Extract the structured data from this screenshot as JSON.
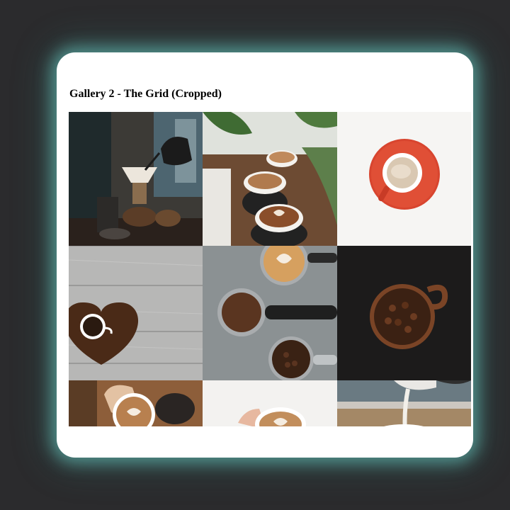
{
  "gallery": {
    "title": "Gallery 2 - The Grid (Cropped)",
    "photos": [
      {
        "subject": "pour-over coffee brewing bar with kettle"
      },
      {
        "subject": "cafe table with latte cups and plants"
      },
      {
        "subject": "red cup of latte on white background"
      },
      {
        "subject": "coffee cup inside heart of coffee beans on wood"
      },
      {
        "subject": "portafilters with ground coffee, beans and latte art"
      },
      {
        "subject": "brown cup full of coffee beans on dark background"
      },
      {
        "subject": "hands holding latte cup on wooden table"
      },
      {
        "subject": "hands holding latte art cup on white"
      },
      {
        "subject": "milk being poured into cup"
      }
    ]
  },
  "colors": {
    "page_background": "#2b2b2d",
    "card_background": "#ffffff",
    "card_glow": "#6ed2c8"
  }
}
